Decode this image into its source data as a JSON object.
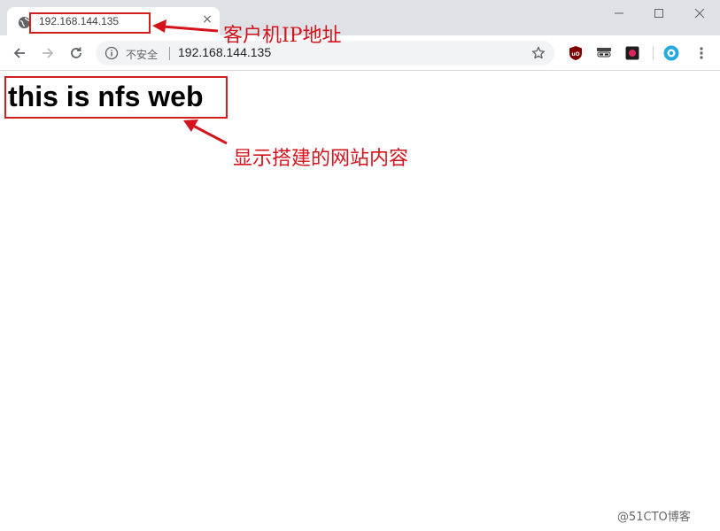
{
  "browser": {
    "tab": {
      "title": "192.168.144.135",
      "close_glyph": "×",
      "favicon": "globe-icon"
    },
    "window_controls": {
      "minimize": "minimize-icon",
      "maximize": "maximize-icon",
      "close": "close-window-icon"
    },
    "toolbar": {
      "back": "back-arrow-icon",
      "forward": "forward-arrow-icon",
      "reload": "reload-icon",
      "security_label": "不安全",
      "url": "192.168.144.135",
      "bookmark": "star-icon",
      "extensions": [
        "ublock-icon",
        "incognito-mask-icon",
        "record-extension-icon",
        "blue-extension-icon"
      ],
      "menu": "more-vert-icon"
    }
  },
  "page": {
    "heading": "this is nfs web"
  },
  "annotations": {
    "client_ip": "客户机IP地址",
    "site_content": "显示搭建的网站内容",
    "color": "#d4141c"
  },
  "watermark": "@51CTO博客"
}
